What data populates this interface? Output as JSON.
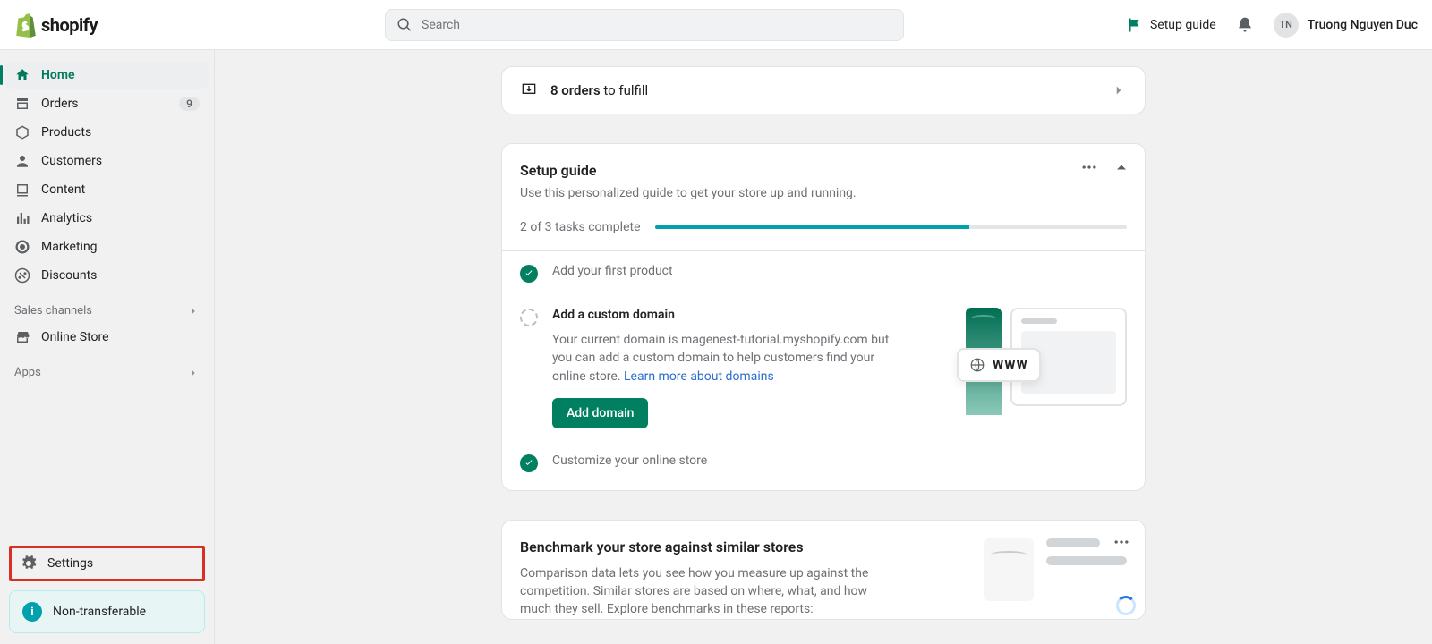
{
  "brand": {
    "name": "shopify"
  },
  "search": {
    "placeholder": "Search"
  },
  "header": {
    "setup_link": "Setup guide",
    "avatar_initials": "TN",
    "username": "Truong Nguyen Duc"
  },
  "sidebar": {
    "items": [
      {
        "label": "Home"
      },
      {
        "label": "Orders",
        "badge": "9"
      },
      {
        "label": "Products"
      },
      {
        "label": "Customers"
      },
      {
        "label": "Content"
      },
      {
        "label": "Analytics"
      },
      {
        "label": "Marketing"
      },
      {
        "label": "Discounts"
      }
    ],
    "sales_channels_heading": "Sales channels",
    "online_store": "Online Store",
    "apps_heading": "Apps",
    "settings": "Settings",
    "callout": "Non-transferable"
  },
  "fulfill": {
    "count": "8 orders",
    "suffix": " to fulfill"
  },
  "setup": {
    "title": "Setup guide",
    "subtitle": "Use this personalized guide to get your store up and running.",
    "progress_label": "2 of 3 tasks complete",
    "progress_pct": 66.6,
    "tasks": [
      {
        "title": "Add your first product",
        "done": true
      },
      {
        "title": "Add a custom domain",
        "done": false,
        "desc_pre": "Your current domain is magenest-tutorial.myshopify.com but you can add a custom domain to help customers find your online store. ",
        "link": "Learn more about domains",
        "button": "Add domain"
      },
      {
        "title": "Customize your online store",
        "done": true
      }
    ],
    "illu_www": "WWW"
  },
  "benchmark": {
    "title": "Benchmark your store against similar stores",
    "desc": "Comparison data lets you see how you measure up against the competition. Similar stores are based on where, what, and how much they sell. Explore benchmarks in these reports:"
  }
}
